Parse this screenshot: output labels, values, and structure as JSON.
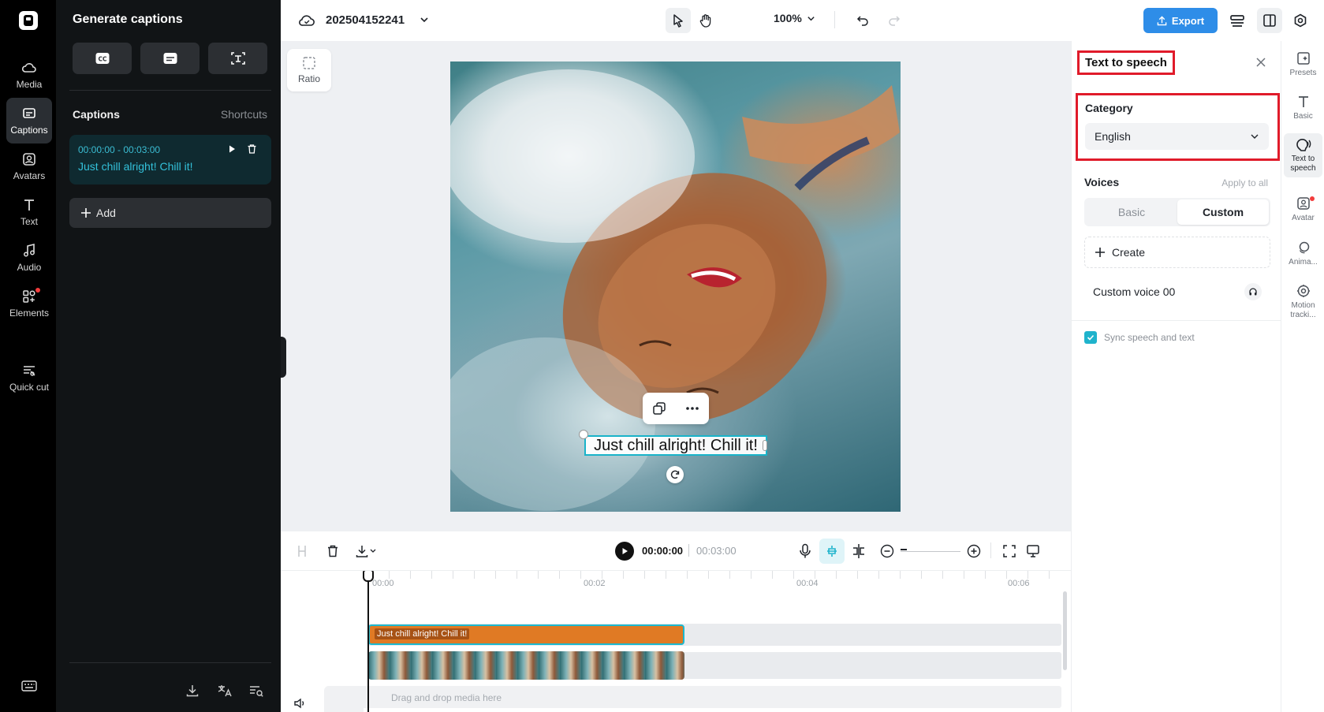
{
  "left_rail": {
    "items": [
      {
        "label": "Media",
        "icon": "cloud-media-icon"
      },
      {
        "label": "Captions",
        "icon": "captions-icon",
        "active": true
      },
      {
        "label": "Avatars",
        "icon": "avatar-icon"
      },
      {
        "label": "Text",
        "icon": "text-icon"
      },
      {
        "label": "Audio",
        "icon": "music-note-icon"
      },
      {
        "label": "Elements",
        "icon": "elements-icon",
        "badge": true
      },
      {
        "label": "Quick cut",
        "icon": "quick-cut-icon"
      }
    ]
  },
  "captions_panel": {
    "title": "Generate captions",
    "section_title": "Captions",
    "shortcuts_label": "Shortcuts",
    "caption": {
      "time_range": "00:00:00 - 00:03:00",
      "text": "Just chill alright! Chill it!"
    },
    "add_label": "Add"
  },
  "topbar": {
    "project_name": "202504152241",
    "zoom": "100%",
    "export_label": "Export"
  },
  "canvas": {
    "ratio_label": "Ratio",
    "caption_overlay": "Just chill alright! Chill it!"
  },
  "timeline": {
    "current_time": "00:00:00",
    "total_time": "00:03:00",
    "ruler": [
      "00:00",
      "00:02",
      "00:04",
      "00:06"
    ],
    "text_clip_label": "Just chill alright! Chill it!",
    "drop_hint": "Drag and drop media here"
  },
  "props": {
    "title": "Text to speech",
    "category_label": "Category",
    "category_value": "English",
    "voices_label": "Voices",
    "apply_all": "Apply to all",
    "tabs": [
      "Basic",
      "Custom"
    ],
    "active_tab": "Custom",
    "create_label": "Create",
    "voice_name": "Custom voice 00",
    "sync_label": "Sync speech and text",
    "sync_checked": true
  },
  "right_rail": {
    "items": [
      {
        "label": "Presets",
        "icon": "presets-icon"
      },
      {
        "label": "Basic",
        "icon": "text-basic-icon"
      },
      {
        "label": "Text to speech",
        "icon": "text-to-speech-icon",
        "active": true
      },
      {
        "label": "Avatar",
        "icon": "avatar-icon",
        "badge": true
      },
      {
        "label": "Anima...",
        "icon": "animation-icon"
      },
      {
        "label": "Motion tracki...",
        "icon": "motion-tracking-icon"
      }
    ]
  },
  "colors": {
    "accent": "#1fb3cc",
    "export_blue": "#2e8de8",
    "highlight_red": "#e01b2a",
    "text_clip_orange": "#e07a24"
  }
}
